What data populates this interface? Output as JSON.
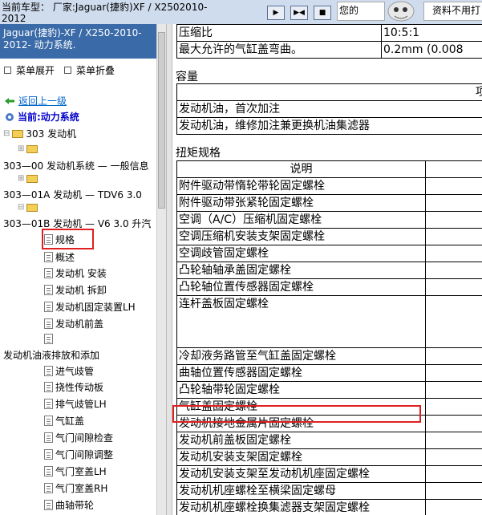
{
  "topbar": {
    "car_model": "当前车型：  厂家:Jaguar(捷豹)XF / X2502010-2012",
    "tip_text": "您的",
    "right_box_text": "资料不用打"
  },
  "sidebar": {
    "title": "Jaguar(捷豹)-XF / X250-2010-2012- 动力系统.",
    "expand_label": "菜单展开",
    "collapse_label": "菜单折叠",
    "back_label": "返回上一级",
    "current_label": "当前:动力系统",
    "tree": [
      {
        "label": "303 发动机"
      },
      {
        "label": ""
      },
      {
        "label": "303—00 发动机系统 — 一般信息"
      },
      {
        "label": ""
      },
      {
        "label": "303—01A 发动机 — TDV6 3.0"
      },
      {
        "label": ""
      },
      {
        "label": "303—01B 发动机 — V6 3.0 升汽"
      },
      {
        "label": "规格"
      },
      {
        "label": "概述"
      },
      {
        "label": "发动机 安装"
      },
      {
        "label": "发动机 拆卸"
      },
      {
        "label": "发动机固定装置LH"
      },
      {
        "label": "发动机前盖"
      },
      {
        "label": ""
      },
      {
        "label": "发动机油液排放和添加"
      },
      {
        "label": "进气歧管"
      },
      {
        "label": "挠性传动板"
      },
      {
        "label": "排气歧管LH"
      },
      {
        "label": "气缸盖"
      },
      {
        "label": "气门间隙检查"
      },
      {
        "label": "气门间隙调整"
      },
      {
        "label": "气门室盖LH"
      },
      {
        "label": "气门室盖RH"
      },
      {
        "label": "曲轴带轮"
      }
    ]
  },
  "content": {
    "top_rows": [
      {
        "name": "压缩比",
        "value": "10:5:1"
      },
      {
        "name": "最大允许的气缸盖弯曲。",
        "value": "0.2mm (0.008"
      }
    ],
    "capacity_title": "容量",
    "capacity_header_right": "项",
    "capacity_rows": [
      "发动机油，首次加注",
      "发动机油，维修加注兼更换机油集滤器"
    ],
    "torque_title": "扭矩规格",
    "torque_header": "说明",
    "torque_rows": [
      "附件驱动带惰轮带轮固定螺栓",
      "附件驱动带张紧轮固定螺栓",
      "空调（A/C）压缩机固定螺栓",
      "空调压缩机安装支架固定螺栓",
      "空调歧管固定螺栓",
      "凸轮轴轴承盖固定螺栓",
      "凸轮轴位置传感器固定螺栓",
      "连杆盖板固定螺栓",
      "冷却液务路管至气缸盖固定螺栓",
      "曲轴位置传感器固定螺栓",
      "凸轮轴带轮固定螺栓",
      "气缸盖固定螺栓",
      "发动机接地金属片固定螺栓",
      "发动机前盖板固定螺栓",
      "发动机安装支架固定螺栓",
      "发动机安装支架至发动机机座固定螺栓",
      "发动机机座螺栓至横梁固定螺母",
      "发动机机座螺栓换集滤器支架固定螺栓"
    ]
  }
}
